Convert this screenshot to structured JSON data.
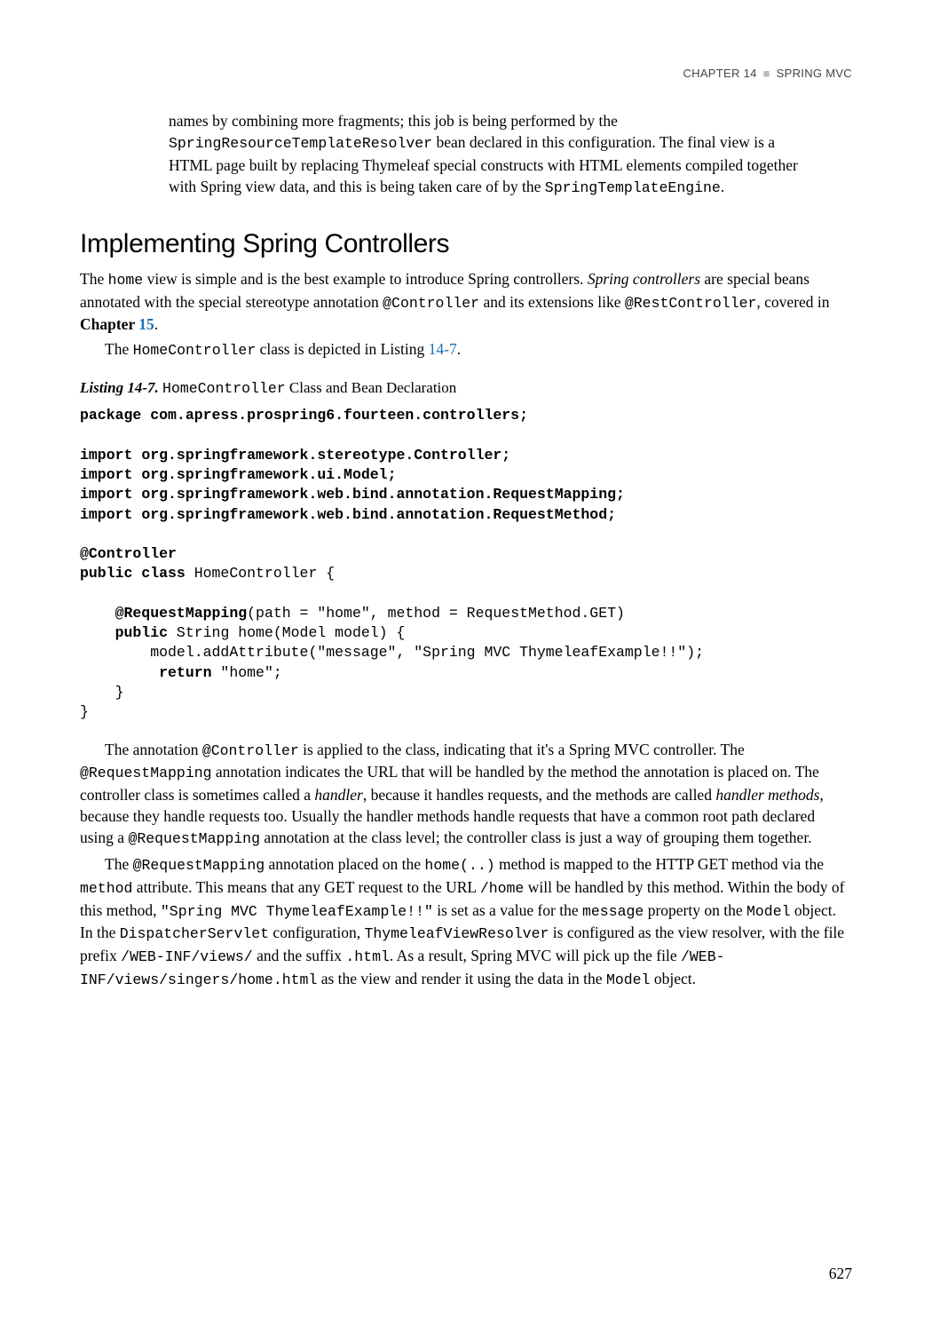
{
  "header": {
    "chapter_label": "CHAPTER 14",
    "separator": "■",
    "chapter_name": "SPRING MVC"
  },
  "intro_1": "names by combining more fragments; this job is being performed by the ",
  "intro_code_1": "SpringResourceTemplateResolver",
  "intro_2": " bean declared in this configuration. The final view is a HTML page built by replacing Thymeleaf special constructs with HTML elements compiled together with Spring view data, and this is being taken care of by the ",
  "intro_code_2": "SpringTemplateEngine",
  "intro_3": ".",
  "section_heading": "Implementing Spring Controllers",
  "p1_a": "The ",
  "p1_code1": "home",
  "p1_b": " view is simple and is the best example to introduce Spring controllers. ",
  "p1_italic": "Spring controllers",
  "p1_c": " are special beans annotated with the special stereotype annotation ",
  "p1_code2": "@Controller",
  "p1_d": " and its extensions like ",
  "p1_code3": "@RestController",
  "p1_e": ", covered in ",
  "p1_bold": "Chapter ",
  "p1_link1": "15",
  "p1_f": ".",
  "p2_a": "The ",
  "p2_code1": "HomeController",
  "p2_b": " class is depicted in Listing ",
  "p2_link1": "14-7",
  "p2_c": ".",
  "listing_lead": "Listing 14-7.",
  "listing_code": "HomeController",
  "listing_rest": " Class and Bean Declaration",
  "code": {
    "l1a": "package",
    "l1b": " com.apress.prospring6.fourteen.controllers;",
    "l2a": "import",
    "l2b": " org.springframework.stereotype.Controller;",
    "l3a": "import",
    "l3b": " org.springframework.ui.Model;",
    "l4a": "import",
    "l4b": " org.springframework.web.bind.annotation.RequestMapping;",
    "l5a": "import",
    "l5b": " org.springframework.web.bind.annotation.RequestMethod;",
    "l6a": "@Controller",
    "l7a": "public class",
    "l7b": " HomeController {",
    "l8a": "    @RequestMapping",
    "l8b": "(path = \"home\", method = RequestMethod.GET)",
    "l9a": "    public",
    "l9b": " String home(Model model) {",
    "l10": "        model.addAttribute(\"message\", \"Spring MVC ThymeleafExample!!\");",
    "l11a": "         return",
    "l11b": " \"home\";",
    "l12": "    }",
    "l13": "}"
  },
  "p3_a": "The annotation ",
  "p3_code1": "@Controller",
  "p3_b": " is applied to the class, indicating that it's a Spring MVC controller. The ",
  "p3_code2": "@RequestMapping",
  "p3_c": " annotation indicates the URL that will be handled by the method the annotation is placed on. The controller class is sometimes called a ",
  "p3_it1": "handler",
  "p3_d": ", because it handles requests, and the methods are called ",
  "p3_it2": "handler methods",
  "p3_e": ", because they handle requests too. Usually the handler methods handle requests that have a common root path declared using a ",
  "p3_code3": "@RequestMapping",
  "p3_f": " annotation at the class level; the controller class is just a way of grouping them together.",
  "p4_a": "The ",
  "p4_code1": "@RequestMapping",
  "p4_b": " annotation placed on the ",
  "p4_code2": "home(..)",
  "p4_c": " method is mapped to the HTTP GET method via the ",
  "p4_code3": "method",
  "p4_d": " attribute. This means that any GET request to the URL ",
  "p4_code4": "/home",
  "p4_e": " will be handled by this method. Within the body of this method, ",
  "p4_code5": "\"Spring MVC ThymeleafExample!!\"",
  "p4_f": " is set as a value for the ",
  "p4_code6": "message",
  "p4_g": " property on the ",
  "p4_code7": "Model",
  "p4_h": " object. In the ",
  "p4_code8": "DispatcherServlet",
  "p4_i": " configuration, ",
  "p4_code9": "ThymeleafViewResolver",
  "p4_j": " is configured as the view resolver, with the file prefix ",
  "p4_code10": "/WEB-INF/views/",
  "p4_k": " and the suffix ",
  "p4_code11": ".html",
  "p4_l": ". As a result, Spring MVC will pick up the file ",
  "p4_code12": "/WEB-INF/views/singers/home.html",
  "p4_m": " as the view and render it using the data in the ",
  "p4_code13": "Model",
  "p4_n": " object.",
  "page_number": "627"
}
